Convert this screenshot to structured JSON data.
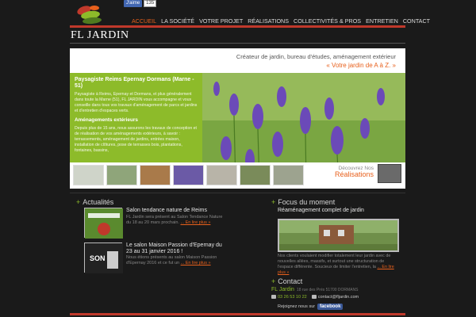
{
  "header": {
    "brand": "FL JARDIN",
    "fb_like": {
      "label": "J'aime",
      "count": "135"
    },
    "nav": [
      {
        "label": "Accueil",
        "active": true
      },
      {
        "label": "La société",
        "active": false
      },
      {
        "label": "Votre projet",
        "active": false
      },
      {
        "label": "Réalisations",
        "active": false
      },
      {
        "label": "Collectivités & Pros",
        "active": false
      },
      {
        "label": "Entretien",
        "active": false
      },
      {
        "label": "Contact",
        "active": false
      }
    ]
  },
  "banner": {
    "tagline1": "Créateur de jardin, bureau d'études, aménagement extérieur",
    "tagline2": "« Votre jardin de A à Z. »",
    "green_box": {
      "title": "Paysagiste Reims Epernay Dormans (Marne - 51)",
      "p1": "Paysagiste à Reims, Epernay et Dormans, et plus généralement dans toute la Marne (51), FL JARDIN vous accompagne et vous conseille dans tous vos travaux d'aménagement de parcs et jardins et d'entretien d'espaces verts.",
      "subtitle": "Aménagements extérieurs",
      "p2": "Depuis plus de 15 ans, nous assurons les travaux de conception et de réalisation de vos aménagements extérieurs, à savoir : terrassements, aménagement de jardins, entrées maison, installation de clôtures, pose de terrasses bois, plantations, fontaines, bassins,"
    },
    "discover": {
      "line1": "Découvrez Nos",
      "line2": "Réalisations"
    }
  },
  "news": {
    "title": "Actualités",
    "items": [
      {
        "title": "Salon tendance nature de Reims",
        "text": "FL Jardin sera présent au Salon Tendance Nature du 18 au 20 mars prochain.",
        "more": "... En lire plus »"
      },
      {
        "title": "Le salon Maison Passion d'Epernay du 23 au 31 janvier 2016 !",
        "text": "Nous étions présents au salon Maison Passion d'Epernay 2016 et ce fut un",
        "more": "... En lire plus »"
      }
    ]
  },
  "focus": {
    "title": "Focus du moment",
    "item_title": "Réaménagement complet de jardin",
    "text": "Nos clients voulaient modifier totalement leur jardin avec de nouvelles allées, massifs, et surtout une structuration de l'espace différente. Soucieux de limiter l'entretien, la",
    "more": "... En lire plus »"
  },
  "contact": {
    "title": "Contact",
    "company": "FL Jardin",
    "address": "18 rue des Prés 51700 DORMANS",
    "phone": "03 26 53 10 22",
    "email": "contact@fljardin.com",
    "join_label": "Rejoignez nous sur",
    "fb_label": "facebook"
  },
  "colors": {
    "accent": "#e8601c",
    "green": "#8dbb2a",
    "red_line": "#c0392b",
    "bg": "#1a1a1a"
  }
}
